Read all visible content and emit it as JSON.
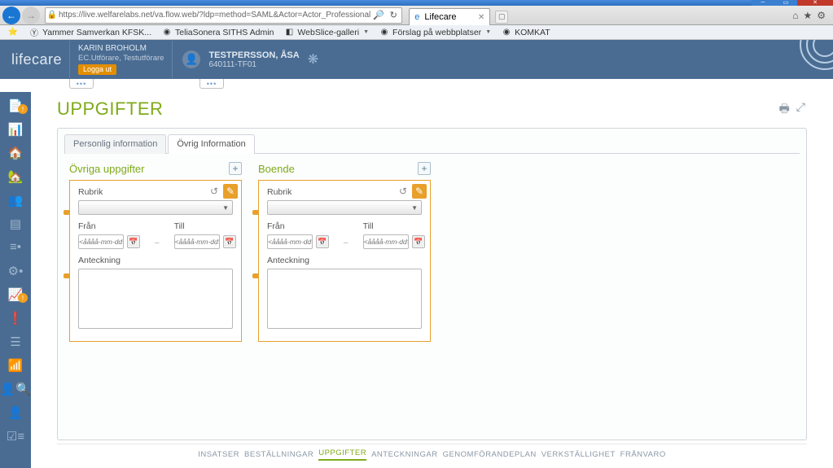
{
  "browser": {
    "url": "https://live.welfarelabs.net/va.flow.web/?ldp=method=SAML&Actor=Actor_Professional",
    "tab_title": "Lifecare",
    "right_icons": [
      "home",
      "star",
      "gear"
    ]
  },
  "favorites": [
    {
      "label": "Yammer  Samverkan KFSK...",
      "icon": "⛃"
    },
    {
      "label": "TeliaSonera SITHS Admin",
      "icon": "◎"
    },
    {
      "label": "WebSlice-galleri",
      "icon": "◧",
      "dropdown": true
    },
    {
      "label": "Förslag på webbplatser",
      "icon": "◉",
      "dropdown": true
    },
    {
      "label": "KOMKAT",
      "icon": "◎"
    }
  ],
  "brand": "lifecare",
  "user": {
    "name": "KARIN  BROHOLM",
    "role": "EC.Utförare, Testutförare",
    "logout": "Logga ut"
  },
  "patient": {
    "name": "TESTPERSSON, ÅSA",
    "id": "640111-TF01"
  },
  "page": {
    "title": "UPPGIFTER",
    "tabs": [
      "Personlig information",
      "Övrig Information"
    ],
    "active_tab": 1
  },
  "cards": [
    {
      "title": "Övriga uppgifter",
      "rubrik": "Rubrik",
      "from": "Från",
      "to": "Till",
      "date_ph": "<åååå-mm-dd>",
      "note_label": "Anteckning"
    },
    {
      "title": "Boende",
      "rubrik": "Rubrik",
      "from": "Från",
      "to": "Till",
      "date_ph": "<åååå-mm-dd>",
      "note_label": "Anteckning"
    }
  ],
  "footer": [
    "INSATSER",
    "BESTÄLLNINGAR",
    "UPPGIFTER",
    "ANTECKNINGAR",
    "GENOMFÖRANDEPLAN",
    "VERKSTÄLLIGHET",
    "FRÅNVARO"
  ],
  "footer_active": 2
}
